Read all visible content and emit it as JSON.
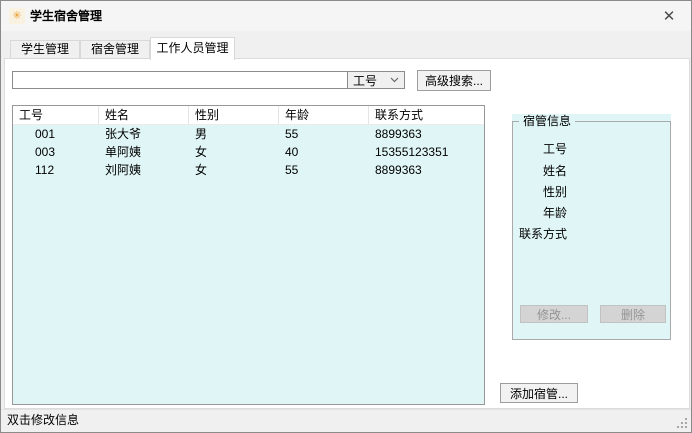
{
  "window": {
    "title": "学生宿舍管理"
  },
  "icons": {
    "app": "✳",
    "close": "✕",
    "dropdown": "chevron-down"
  },
  "tabs": [
    {
      "label": "学生管理"
    },
    {
      "label": "宿舍管理"
    },
    {
      "label": "工作人员管理"
    }
  ],
  "active_tab": "工作人员管理",
  "search": {
    "value": "",
    "field": "工号",
    "advanced_label": "高级搜索..."
  },
  "table": {
    "columns": [
      "工号",
      "姓名",
      "性别",
      "年龄",
      "联系方式"
    ],
    "rows": [
      [
        "001",
        "张大爷",
        "男",
        "55",
        "8899363"
      ],
      [
        "003",
        "单阿姨",
        "女",
        "40",
        "15355123351"
      ],
      [
        "112",
        "刘阿姨",
        "女",
        "55",
        "8899363"
      ]
    ]
  },
  "panel": {
    "title": "宿管信息",
    "fields": [
      "工号",
      "姓名",
      "性别",
      "年龄",
      "联系方式"
    ],
    "modify_label": "修改...",
    "delete_label": "删除"
  },
  "add_button_label": "添加宿管...",
  "statusbar": {
    "text": "双击修改信息"
  },
  "colors": {
    "list_bg": "#e0f5f6",
    "panel_bg": "#e0f5f6",
    "window_bg": "#f0f0f0",
    "page_bg": "#ffffff",
    "disabled_text": "#949494"
  }
}
